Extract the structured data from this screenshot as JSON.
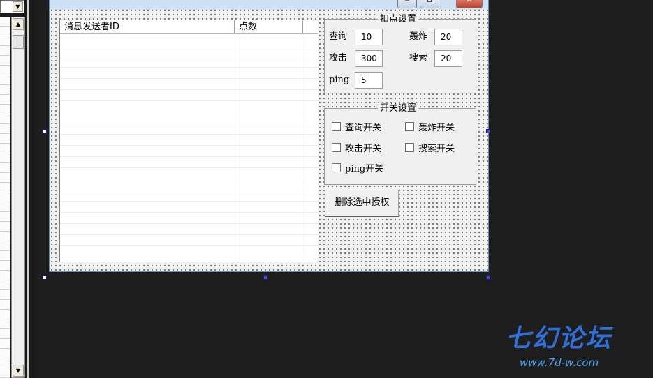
{
  "list": {
    "col_id": "消息发送者ID",
    "col_points": "点数",
    "rows": 20
  },
  "deduct_group": {
    "title": "扣点设置",
    "query_label": "查询",
    "query_value": "10",
    "bomb_label": "轰炸",
    "bomb_value": "20",
    "attack_label": "攻击",
    "attack_value": "300",
    "search_label": "搜索",
    "search_value": "20",
    "ping_label": "ping",
    "ping_value": "5"
  },
  "switch_group": {
    "title": "开关设置",
    "query_switch": "查询开关",
    "bomb_switch": "轰炸开关",
    "attack_switch": "攻击开关",
    "search_switch": "搜索开关",
    "ping_switch": "ping开关"
  },
  "actions": {
    "delete_auth": "删除选中授权"
  },
  "window_buttons": {
    "minimize": "‒",
    "maximize": "▫",
    "close": "✕"
  },
  "watermark": {
    "title": "七幻论坛",
    "url": "www.7d-w.com"
  },
  "colors": {
    "form_bg": "#f0f0f0",
    "selection": "#1a1a8a",
    "watermark": "#2f6fd6"
  }
}
